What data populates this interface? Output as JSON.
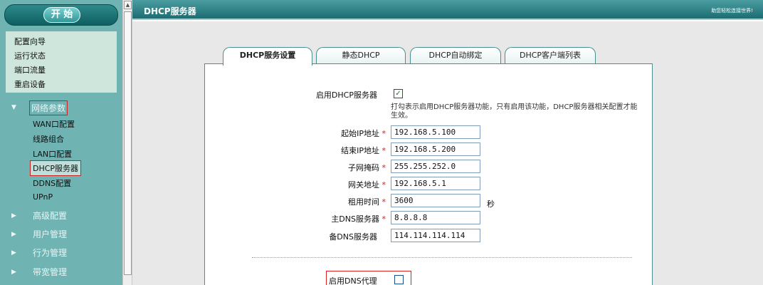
{
  "sidebar": {
    "start_label": "开 始",
    "quick_items": [
      "配置向导",
      "运行状态",
      "端口流量",
      "重启设备"
    ],
    "network_section": "网络参数",
    "network_items": [
      "WAN口配置",
      "线路组合",
      "LAN口配置",
      "DHCP服务器",
      "DDNS配置",
      "UPnP"
    ],
    "other_sections": [
      "高级配置",
      "用户管理",
      "行为管理",
      "带宽管理"
    ]
  },
  "main": {
    "title": "DHCP服务器",
    "brand": "助您轻松连接世界!",
    "tabs": [
      "DHCP服务设置",
      "静态DHCP",
      "DHCP自动绑定",
      "DHCP客户端列表"
    ],
    "form": {
      "enable_dhcp_label": "启用DHCP服务器",
      "enable_dhcp_checked": true,
      "hint": "打勾表示启用DHCP服务器功能，只有启用该功能，DHCP服务器相关配置才能生效。",
      "required_mark": "*",
      "start_ip_label": "起始IP地址",
      "start_ip": "192.168.5.100",
      "end_ip_label": "结束IP地址",
      "end_ip": "192.168.5.200",
      "subnet_label": "子网掩码",
      "subnet": "255.255.252.0",
      "gateway_label": "网关地址",
      "gateway": "192.168.5.1",
      "lease_label": "租用时间",
      "lease": "3600",
      "lease_unit": "秒",
      "dns1_label": "主DNS服务器",
      "dns1": "8.8.8.8",
      "dns2_label": "备DNS服务器",
      "dns2": "114.114.114.114",
      "dns_proxy_label": "启用DNS代理",
      "dns_proxy_checked": false
    }
  },
  "colors": {
    "sidebar_bg": "#6fb3b3",
    "title_bar": "#1c6d72",
    "highlight": "#cc2222",
    "required": "#dd1111"
  },
  "icons": [
    "triangle-down-icon",
    "triangle-right-icon",
    "checkmark-icon",
    "scroll-up-icon"
  ]
}
